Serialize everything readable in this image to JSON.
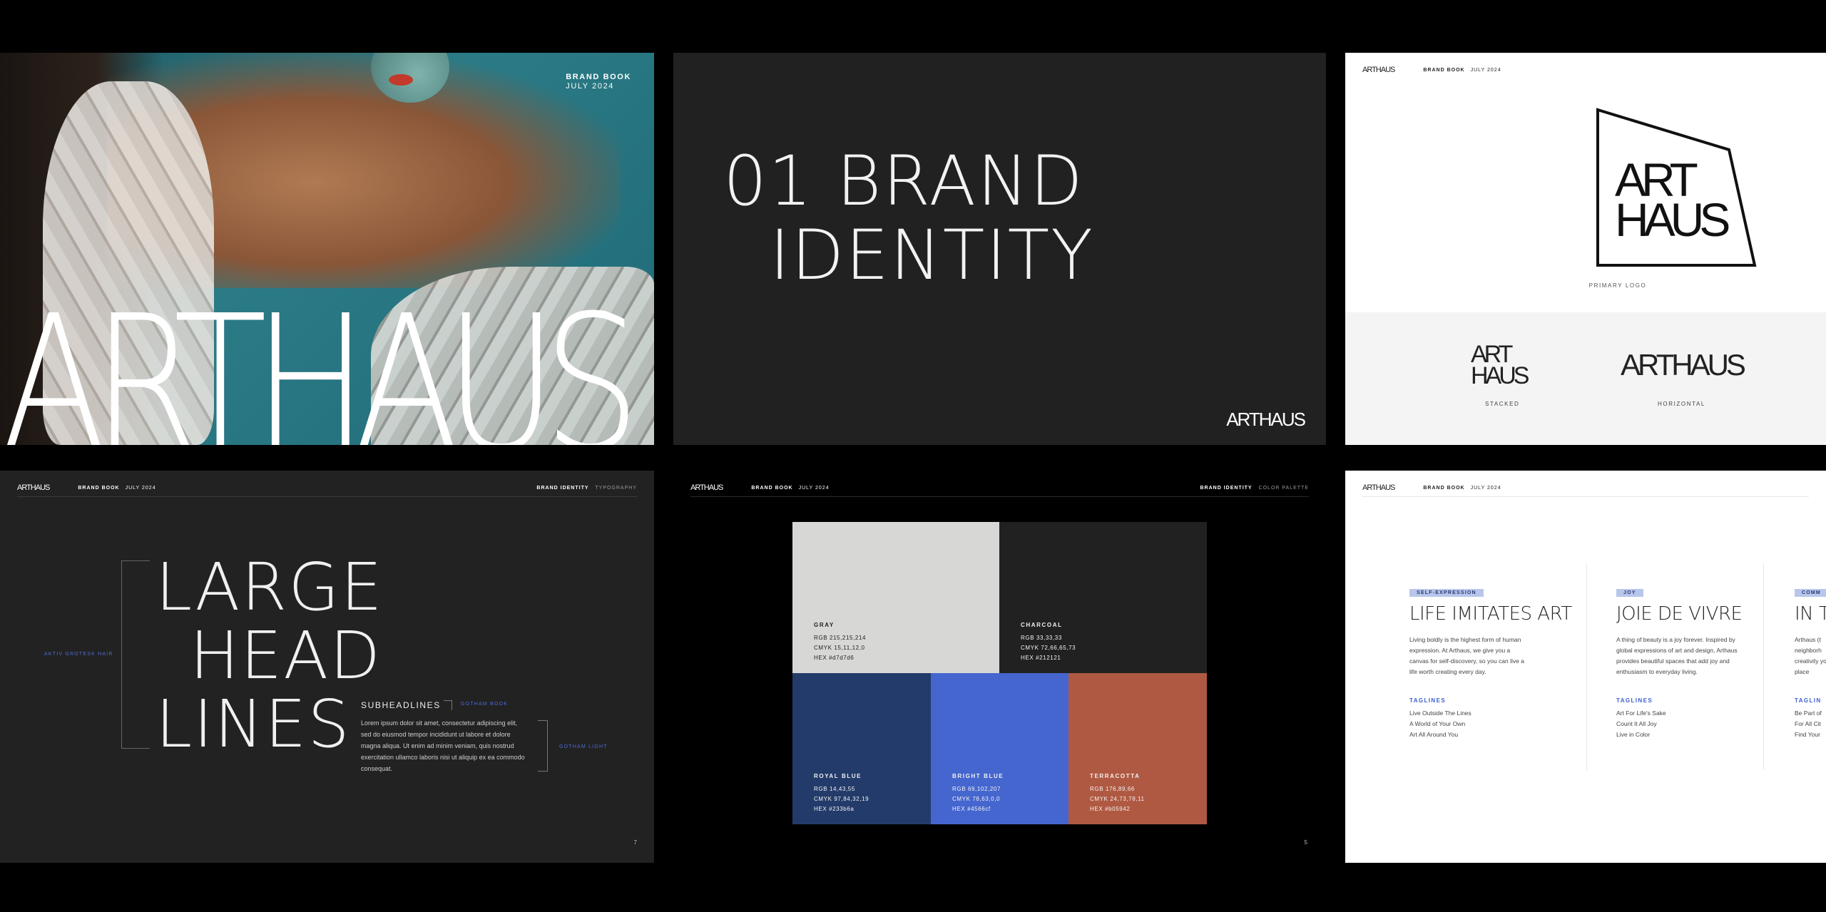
{
  "cover": {
    "meta_title": "BRAND BOOK",
    "meta_date": "JULY 2024",
    "title": "ARTHAUS"
  },
  "section": {
    "line1": "01 BRAND",
    "line2": "IDENTITY",
    "logo": "ARTHAUS"
  },
  "header": {
    "logo": "ARTHAUS",
    "book": "BRAND BOOK",
    "date": "JULY 2024"
  },
  "logos": {
    "primary_top": "ART",
    "primary_bottom": "HAUS",
    "primary_caption": "PRIMARY LOGO",
    "stacked_top": "ART",
    "stacked_bottom": "HAUS",
    "stacked_caption": "STACKED",
    "horizontal": "ARTHAUS",
    "horizontal_caption": "HORIZONTAL"
  },
  "typography": {
    "crumb_section": "BRAND IDENTITY",
    "crumb_page": "TYPOGRAPHY",
    "large_1": "LARGE",
    "large_2": "HEAD",
    "large_3": "LINES",
    "font_large": "AKTIV GROTESK HAIR",
    "subheadline": "SUBHEADLINES",
    "font_sub": "GOTHAM BOOK",
    "body": "Lorem ipsum dolor sit amet, consectetur adipiscing elit, sed do eiusmod tempor incididunt ut labore et dolore magna aliqua. Ut enim ad minim veniam, quis nostrud exercitation ullamco laboris nisi ut aliquip ex ea commodo consequat.",
    "font_body": "GOTHAM LIGHT",
    "page": "7"
  },
  "palette": {
    "crumb_section": "BRAND IDENTITY",
    "crumb_page": "COLOR PALETTE",
    "page": "5",
    "colors": [
      {
        "name": "GRAY",
        "rgb": "RGB  215,215,214",
        "cmyk": "CMYK  15,11,12,0",
        "hex": "HEX  #d7d7d6",
        "swatch": "#d7d7d6",
        "text": "#222222"
      },
      {
        "name": "CHARCOAL",
        "rgb": "RGB  33,33,33",
        "cmyk": "CMYK  72,66,65,73",
        "hex": "HEX  #212121",
        "swatch": "#212121",
        "text": "#f2f2f2"
      },
      {
        "name": "ROYAL BLUE",
        "rgb": "RGB  14,43,55",
        "cmyk": "CMYK  97,84,32,19",
        "hex": "HEX  #233b6a",
        "swatch": "#233b6a",
        "text": "#f2f2f2"
      },
      {
        "name": "BRIGHT BLUE",
        "rgb": "RGB  69,102,207",
        "cmyk": "CMYK  78,63,0,0",
        "hex": "HEX  #4566cf",
        "swatch": "#4566cf",
        "text": "#f2f2f2"
      },
      {
        "name": "TERRACOTTA",
        "rgb": "RGB  176,89,66",
        "cmyk": "CMYK  24,73,78,11",
        "hex": "HEX  #b05942",
        "swatch": "#b05942",
        "text": "#f2f2f2"
      }
    ]
  },
  "voice": {
    "columns": [
      {
        "tag": "SELF-EXPRESSION",
        "title": "LIFE IMITATES ART",
        "body": "Living boldly is the highest form of human expression. At Arthaus, we give you a canvas for self-discovery, so you can live a life worth creating every day.",
        "taglines_label": "TAGLINES",
        "taglines": [
          "Live Outside The Lines",
          "A World of Your Own",
          "Art All Around You"
        ]
      },
      {
        "tag": "JOY",
        "title": "JOIE DE VIVRE",
        "body": "A thing of beauty is a joy forever. Inspired by global expressions of art and design, Arthaus provides beautiful spaces that add joy and enthusiasm to everyday living.",
        "taglines_label": "TAGLINES",
        "taglines": [
          "Art For Life's Sake",
          "Count It All Joy",
          "Live in Color"
        ]
      },
      {
        "tag": "COMM",
        "title": "IN T",
        "body": "Arthaus (t neighborh creativity your place",
        "taglines_label": "TAGLIN",
        "taglines": [
          "Be Part of",
          "For All Cit",
          "Find Your"
        ]
      }
    ]
  },
  "colors": {
    "accent_blue": "#4566cf",
    "tag_bg": "#b9c6ec"
  }
}
